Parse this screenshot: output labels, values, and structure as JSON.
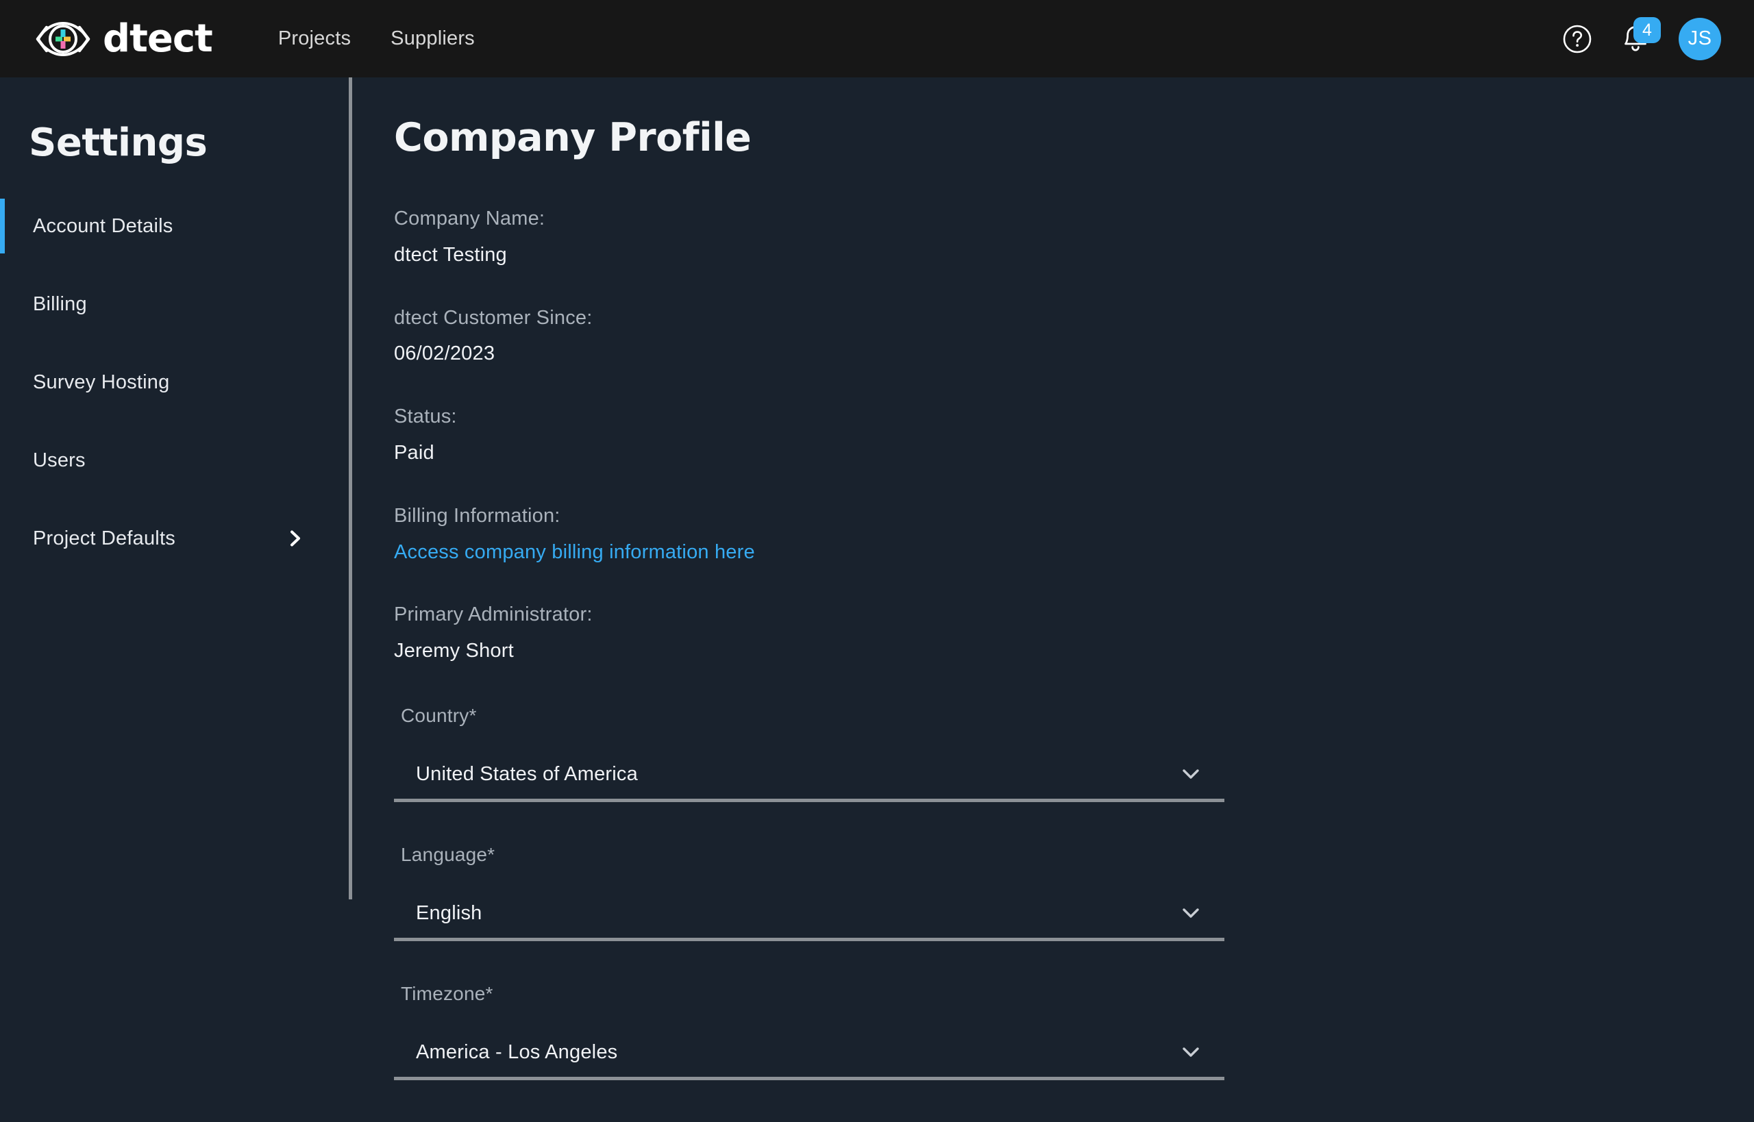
{
  "header": {
    "brand_name": "dtect",
    "logo_icon": "eye-plus-logo",
    "nav": [
      {
        "label": "Projects",
        "name": "nav-projects"
      },
      {
        "label": "Suppliers",
        "name": "nav-suppliers"
      }
    ],
    "help_icon": "question-circle-icon",
    "notifications_icon": "bell-icon",
    "notification_count": "4",
    "avatar_initials": "JS",
    "accent_color": "#36abf2",
    "bar_color": "#171717"
  },
  "sidebar": {
    "title": "Settings",
    "items": [
      {
        "label": "Account Details",
        "active": true,
        "chevron": false
      },
      {
        "label": "Billing",
        "active": false,
        "chevron": false
      },
      {
        "label": "Survey Hosting",
        "active": false,
        "chevron": false
      },
      {
        "label": "Users",
        "active": false,
        "chevron": false
      },
      {
        "label": "Project Defaults",
        "active": false,
        "chevron": true
      }
    ],
    "chevron_icon": "chevron-right-icon",
    "active_indicator_color": "#36abf2"
  },
  "main": {
    "page_title": "Company Profile",
    "info": [
      {
        "label": "Company Name:",
        "value": "dtect Testing",
        "type": "text"
      },
      {
        "label": "dtect Customer Since:",
        "value": "06/02/2023",
        "type": "text"
      },
      {
        "label": "Status:",
        "value": "Paid",
        "type": "text"
      },
      {
        "label": "Billing Information:",
        "value": "Access company billing information here",
        "type": "link"
      },
      {
        "label": "Primary Administrator:",
        "value": "Jeremy Short",
        "type": "text"
      }
    ],
    "fields": [
      {
        "label": "Country*",
        "value": "United States of America",
        "icon": "chevron-down-icon"
      },
      {
        "label": "Language*",
        "value": "English",
        "icon": "chevron-down-icon"
      },
      {
        "label": "Timezone*",
        "value": "America - Los Angeles",
        "icon": "chevron-down-icon"
      }
    ],
    "link_color": "#36abf2",
    "underline_color": "#8c9196",
    "background_color": "#19222d"
  }
}
